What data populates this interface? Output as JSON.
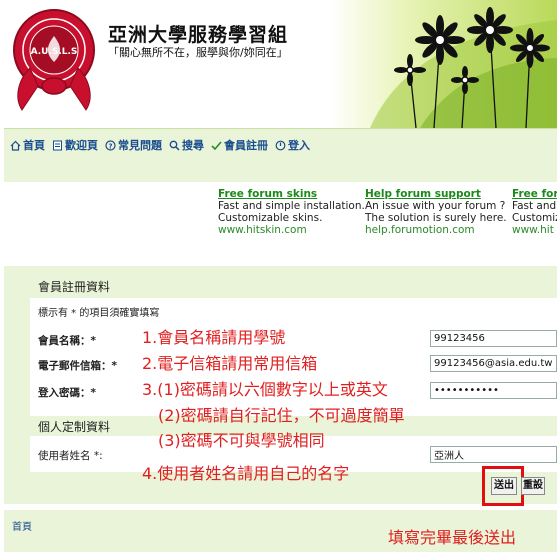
{
  "site": {
    "title": "亞洲大學服務學習組",
    "motto": "「關心無所不在，服學與你/妳同在」",
    "logo_text": "A.U.S.L.S"
  },
  "nav": {
    "items": [
      {
        "label": "首頁",
        "icon": "home-icon"
      },
      {
        "label": "歡迎頁",
        "icon": "page-icon"
      },
      {
        "label": "常見問題",
        "icon": "question-icon"
      },
      {
        "label": "搜尋",
        "icon": "search-icon"
      },
      {
        "label": "會員註冊",
        "icon": "register-icon"
      },
      {
        "label": "登入",
        "icon": "login-icon"
      }
    ]
  },
  "ads": [
    {
      "title": "Free forum skins",
      "line1": "Fast and simple installation.",
      "line2": "Customizable skins.",
      "url": "www.hitskin.com"
    },
    {
      "title": "Help forum support",
      "line1": "An issue with your forum ?",
      "line2": "The solution is surely here.",
      "url": "help.forumotion.com"
    },
    {
      "title": "Free for",
      "line1": "Fast and",
      "line2": "Customiz",
      "url": "www.hit"
    }
  ],
  "form": {
    "section1_title": "會員註冊資料",
    "required_note": "標示有 * 的項目須確實填寫",
    "username_label": "會員名稱：*",
    "username_value": "99123456",
    "email_label": "電子郵件信箱：*",
    "email_value": "99123456@asia.edu.tw",
    "password_label": "登入密碼：*",
    "password_value": "•••••••••••",
    "section2_title": "個人定制資料",
    "display_name_label": "使用者姓名 *:",
    "display_name_value": "亞洲人",
    "submit_label": "送出",
    "reset_label": "重設"
  },
  "hints": {
    "h1": "1.會員名稱請用學號",
    "h2": "2.電子信箱請用常用信箱",
    "h3": "3.(1)密碼請以六個數字以上或英文",
    "h4": "(2)密碼請自行記住，不可過度簡單",
    "h5": "(3)密碼不可與學號相同",
    "h6": "4.使用者姓名請用自己的名字"
  },
  "footer": {
    "link": "首頁",
    "note": "填寫完畢最後送出"
  },
  "colors": {
    "panel_bg": "#e9f4d8",
    "hint_red": "#e02020",
    "link_blue": "#1a4d8f",
    "ad_green": "#1b8a1b"
  }
}
